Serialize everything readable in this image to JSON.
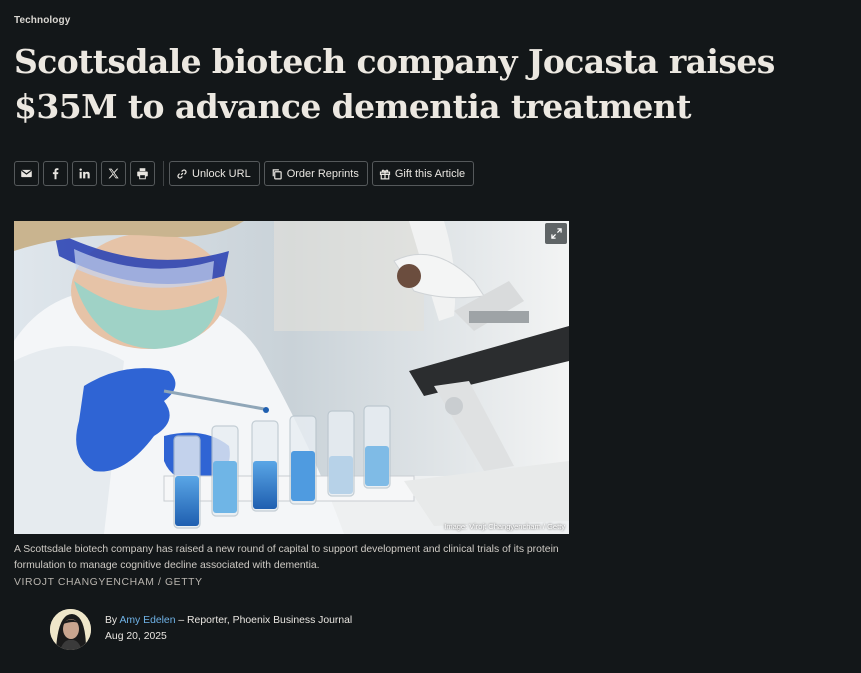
{
  "article": {
    "category": "Technology",
    "headline": "Scottsdale biotech company Jocasta raises $35M to advance dementia treatment"
  },
  "share_bar": {
    "icons": [
      "email-icon",
      "facebook-icon",
      "linkedin-icon",
      "x-icon",
      "print-icon"
    ],
    "unlock_label": "Unlock URL",
    "reprints_label": "Order Reprints",
    "gift_label": "Gift this Article"
  },
  "figure": {
    "image_credit": "Image: Virojt Changyencham / Getty",
    "caption": "A Scottsdale biotech company has raised a new round of capital to support development and clinical trials of its protein formulation to manage cognitive decline associated with dementia.",
    "photo_credit": "VIROJT CHANGYENCHAM / GETTY"
  },
  "byline": {
    "prefix": "By",
    "author": "Amy Edelen",
    "role": "– Reporter, Phoenix Business Journal",
    "date": "Aug 20, 2025"
  },
  "colors": {
    "background": "#131719",
    "text": "#e9e6e1",
    "link": "#6fb2e6",
    "border": "#55595b"
  }
}
